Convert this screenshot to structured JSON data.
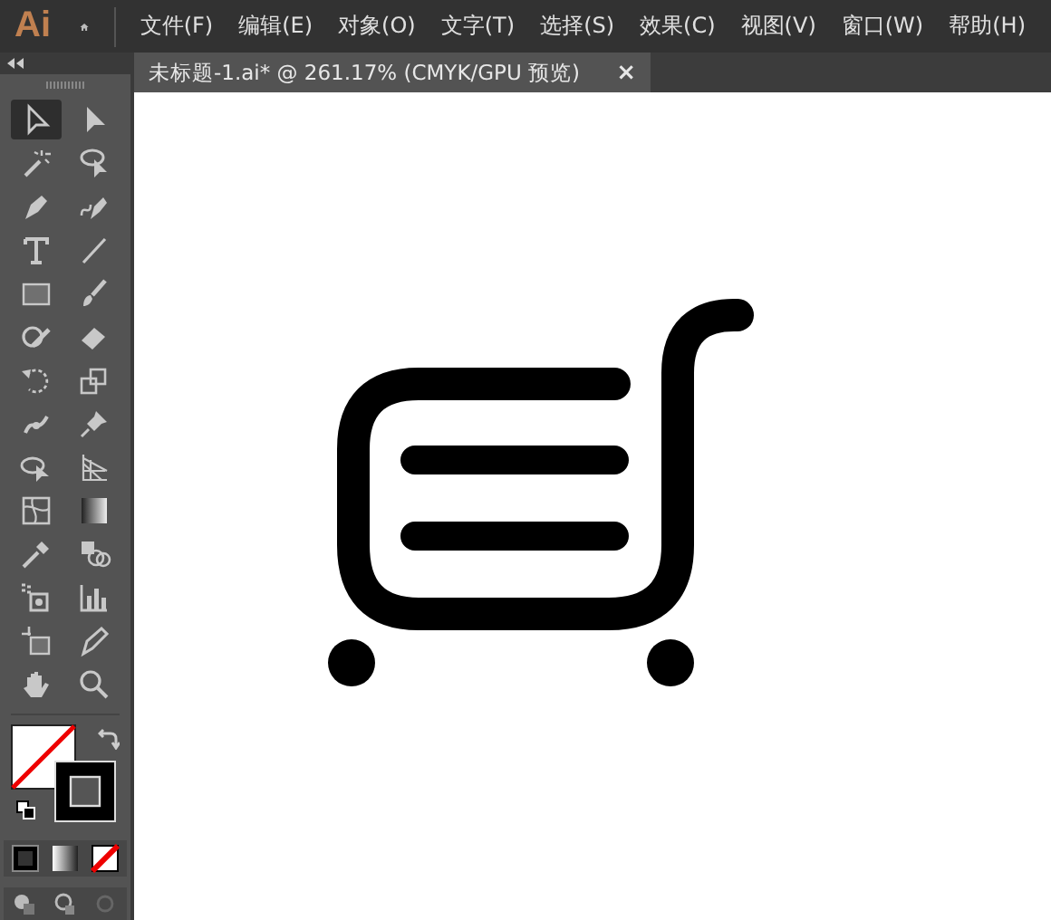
{
  "menu_bar": {
    "logo": "Ai",
    "items": [
      "文件(F)",
      "编辑(E)",
      "对象(O)",
      "文字(T)",
      "选择(S)",
      "效果(C)",
      "视图(V)",
      "窗口(W)",
      "帮助(H)"
    ]
  },
  "document_tab": {
    "title": "未标题-1.ai* @ 261.17% (CMYK/GPU 预览)",
    "close": "×"
  },
  "tools": [
    {
      "selected": true
    },
    {
      "selected": false
    },
    {
      "selected": false
    },
    {
      "selected": false
    },
    {
      "selected": false
    },
    {
      "selected": false
    },
    {
      "selected": false
    },
    {
      "selected": false
    },
    {
      "selected": false
    },
    {
      "selected": false
    },
    {
      "selected": false
    },
    {
      "selected": false
    },
    {
      "selected": false
    },
    {
      "selected": false
    },
    {
      "selected": false
    },
    {
      "selected": false
    },
    {
      "selected": false
    },
    {
      "selected": false
    },
    {
      "selected": false
    },
    {
      "selected": false
    },
    {
      "selected": false
    },
    {
      "selected": false
    },
    {
      "selected": false
    },
    {
      "selected": false
    },
    {
      "selected": false
    },
    {
      "selected": false
    },
    {
      "selected": false
    },
    {
      "selected": false
    }
  ]
}
